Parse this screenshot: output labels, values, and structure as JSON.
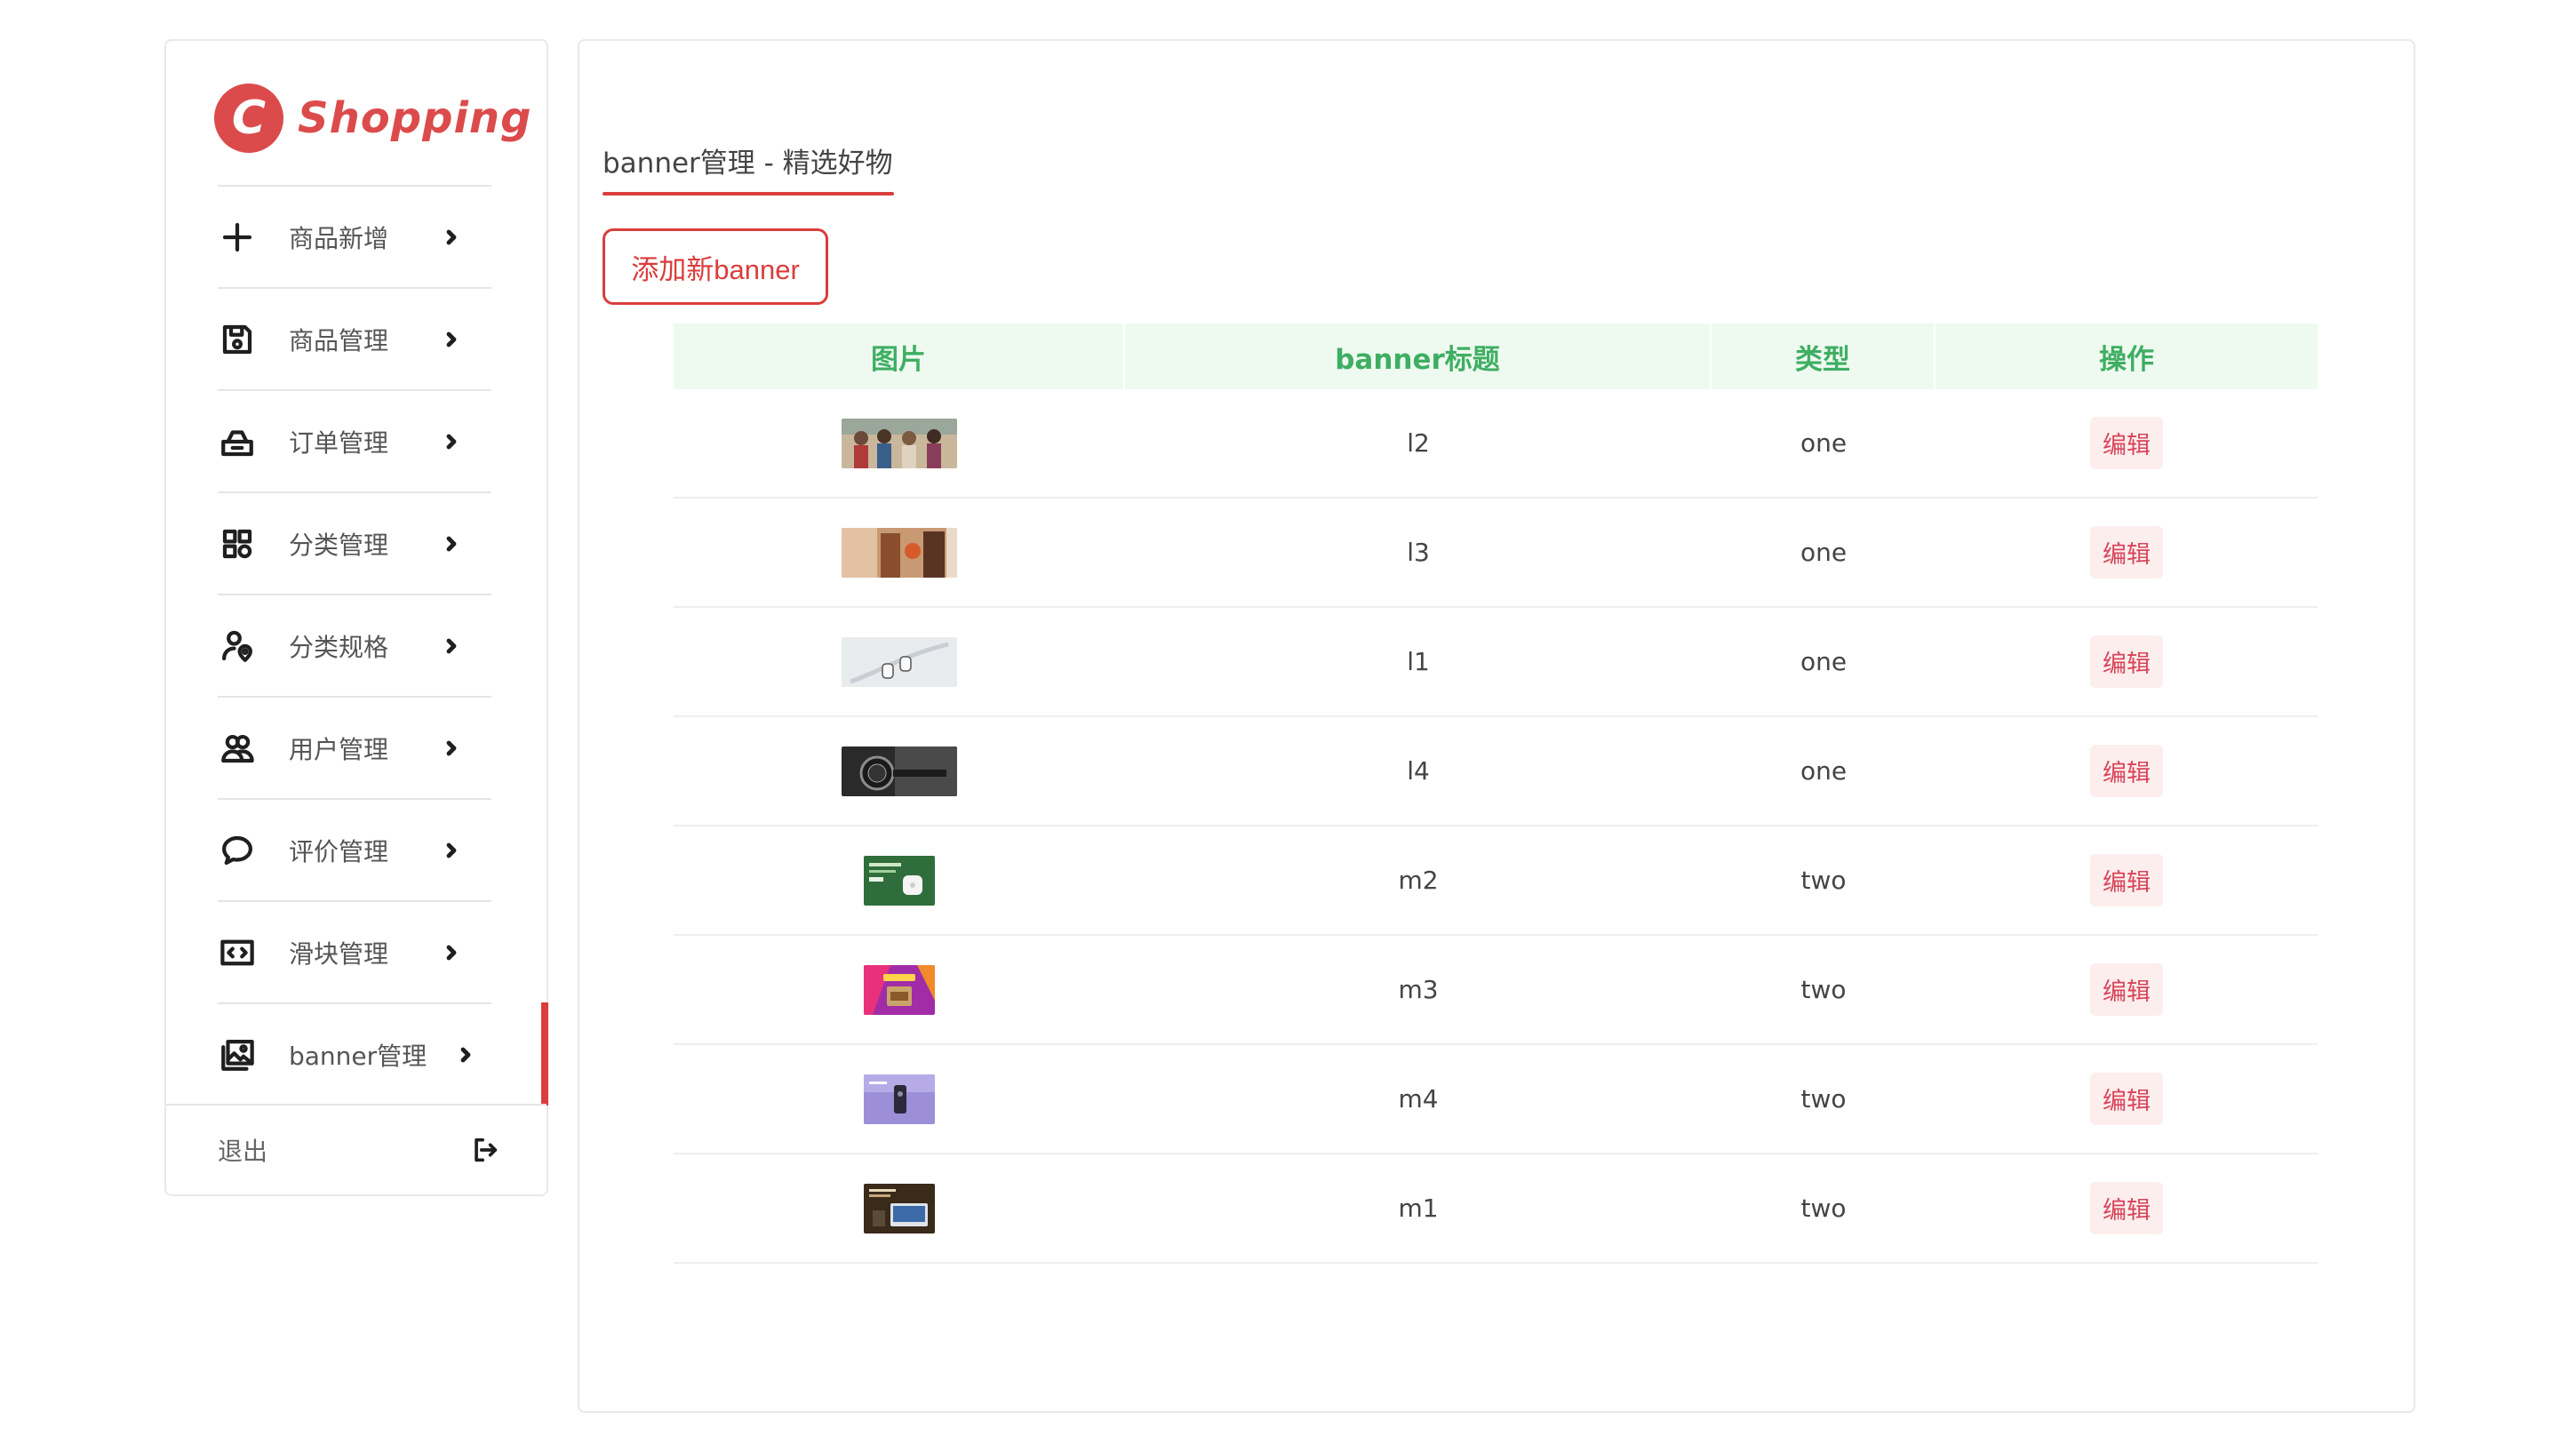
{
  "brand": {
    "mark": "C",
    "name": "Shopping",
    "color": "#dc4b4b"
  },
  "sidebar": {
    "items": [
      {
        "label": "商品新增",
        "icon": "plus-icon"
      },
      {
        "label": "商品管理",
        "icon": "floppy-disk-icon"
      },
      {
        "label": "订单管理",
        "icon": "basket-icon"
      },
      {
        "label": "分类管理",
        "icon": "grid-icon"
      },
      {
        "label": "分类规格",
        "icon": "person-pin-icon"
      },
      {
        "label": "用户管理",
        "icon": "users-icon"
      },
      {
        "label": "评价管理",
        "icon": "chat-bubble-icon"
      },
      {
        "label": "滑块管理",
        "icon": "slider-code-icon"
      },
      {
        "label": "banner管理",
        "icon": "images-icon",
        "active": true
      }
    ],
    "logout_label": "退出"
  },
  "main": {
    "title": "banner管理 - 精选好物",
    "add_button_label": "添加新banner",
    "table": {
      "headers": [
        "图片",
        "banner标题",
        "类型",
        "操作"
      ],
      "rows": [
        {
          "image": "banner thumbnail (people group)",
          "title": "l2",
          "type": "one",
          "action": "编辑"
        },
        {
          "image": "banner thumbnail (hands, warm tones)",
          "title": "l3",
          "type": "one",
          "action": "编辑"
        },
        {
          "image": "banner thumbnail (white earphones)",
          "title": "l1",
          "type": "one",
          "action": "编辑"
        },
        {
          "image": "banner thumbnail (dark watch)",
          "title": "l4",
          "type": "one",
          "action": "编辑"
        },
        {
          "image": "banner thumbnail (green earbuds ad)",
          "title": "m2",
          "type": "two",
          "action": "编辑"
        },
        {
          "image": "banner thumbnail (purple promo)",
          "title": "m3",
          "type": "two",
          "action": "编辑"
        },
        {
          "image": "banner thumbnail (lavender phone)",
          "title": "m4",
          "type": "two",
          "action": "编辑"
        },
        {
          "image": "banner thumbnail (dark laptop ad)",
          "title": "m1",
          "type": "two",
          "action": "编辑"
        }
      ]
    }
  },
  "colors": {
    "accent": "#d93d3d",
    "header_bg": "#eefaf0",
    "header_text": "#3fae63",
    "edit_bg": "#fdeeee",
    "edit_text": "#d8455a"
  }
}
